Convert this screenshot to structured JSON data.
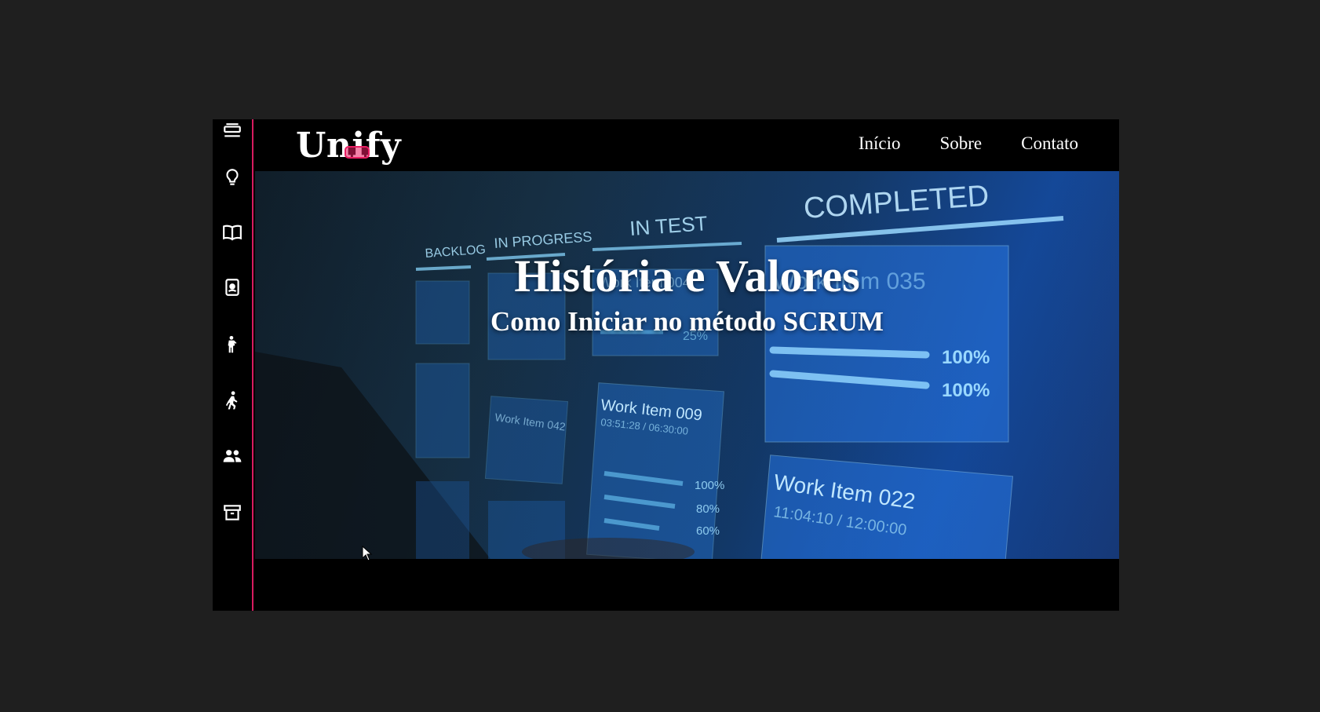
{
  "brand": {
    "logo": "Unify",
    "accent_color": "#e91e63"
  },
  "nav": {
    "items": [
      {
        "label": "Início"
      },
      {
        "label": "Sobre"
      },
      {
        "label": "Contato"
      }
    ]
  },
  "sidebar": {
    "items": [
      {
        "icon": "menu-icon"
      },
      {
        "icon": "lightbulb-icon"
      },
      {
        "icon": "book-icon"
      },
      {
        "icon": "id-badge-icon"
      },
      {
        "icon": "person-standing-icon"
      },
      {
        "icon": "person-walking-icon"
      },
      {
        "icon": "users-icon"
      },
      {
        "icon": "archive-icon"
      }
    ]
  },
  "hero": {
    "title": "História e Valores",
    "subtitle": "Como Iniciar no método SCRUM",
    "board": {
      "columns": [
        "BACKLOG",
        "IN PROGRESS",
        "IN TEST",
        "COMPLETED"
      ],
      "cards": [
        {
          "title": "Work Item 035"
        },
        {
          "title": "Work Item 009",
          "time": "03:51:28 / 06:30:00",
          "progress": [
            "100%",
            "80%",
            "60%"
          ]
        },
        {
          "title": "Work Item 022",
          "time": "11:04:10 / 12:00:00"
        },
        {
          "title": "Work Item 042"
        },
        {
          "title": "Work Item 004"
        }
      ],
      "completed_progress": [
        "100%",
        "100%"
      ],
      "in_test_progress": "25%"
    }
  }
}
